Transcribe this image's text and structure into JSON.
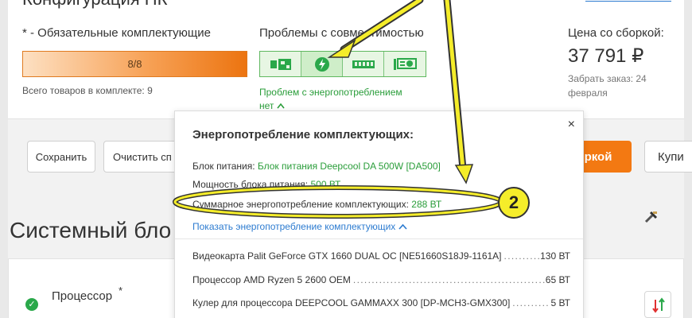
{
  "summary": {
    "required_label": "* - Обязательные комплектующие",
    "progress_text": "8/8",
    "progress_fraction": 1.0,
    "total_items": "Всего товаров в комплекте: 9",
    "compat_label": "Проблемы с совместимостью",
    "compat_icons": [
      "motherboard-icon",
      "power-icon",
      "ram-icon",
      "gpu-icon"
    ],
    "compat_link": "Проблем с энергопотреблением нет",
    "price_label": "Цена со сборкой:",
    "price_value": "37 791 ₽",
    "pickup": "Забрать заказ: 24 февраля"
  },
  "toolbar": {
    "save_label": "Сохранить",
    "clear_label": "Очистить сп",
    "order_label": "ркой",
    "buy_label": "Купи"
  },
  "section": {
    "title": "Системный бло",
    "processor_label": "Процессор",
    "required_star": "*"
  },
  "popup": {
    "title": "Энергопотребление комплектующих:",
    "close": "×",
    "psu_label": "Блок питания: ",
    "psu_value": "Блок питания Deepcool DA 500W [DA500]",
    "power_label": "Мощность блока питания: ",
    "power_value": "500 ВТ",
    "total_label": "Суммарное энергопотребление комплектующих: ",
    "total_value": "288 ВТ",
    "show_link": "Показать энергопотребление комплектующих",
    "details": [
      {
        "name": "Видеокарта Palit GeForce GTX 1660 DUAL OC [NE51660S18J9-1161A]",
        "value": "130 ВТ"
      },
      {
        "name": "Процессор AMD Ryzen 5 2600 OEM",
        "value": "65 ВТ"
      },
      {
        "name": "Кулер для процессора DEEPCOOL GAMMAXX 300 [DP-MCH3-GMX300]",
        "value": "5 ВТ"
      }
    ]
  },
  "annotation": {
    "badge": "2"
  },
  "colors": {
    "accent_green": "#2a9d3a",
    "accent_orange": "#f37912",
    "link_blue": "#2c7bd0",
    "annotation_yellow": "#f5ed2a"
  }
}
